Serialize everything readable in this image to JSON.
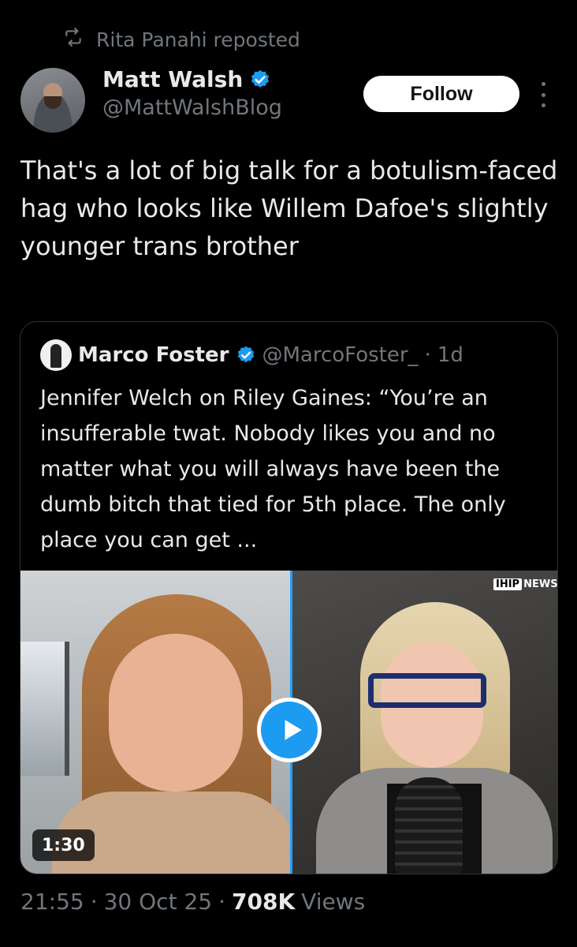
{
  "repost": {
    "icon": "retweet-icon",
    "text": "Rita Panahi reposted"
  },
  "author": {
    "name": "Matt Walsh",
    "handle": "@MattWalshBlog",
    "verified_color": "#1d9bf0"
  },
  "follow_label": "Follow",
  "tweet": {
    "text": "That's a lot of big talk for a botulism-faced hag who looks like Willem Dafoe's slightly younger trans brother"
  },
  "quote": {
    "name": "Marco Foster",
    "handle": "@MarcoFoster_",
    "separator": "·",
    "time": "1d",
    "text": "Jennifer Welch on Riley Gaines: “You’re an insufferable twat. Nobody likes you and no matter what you will always have been the dumb bitch that tied for 5th place. The only place you can get ...",
    "video": {
      "duration": "1:30",
      "logo_box": "IHIP",
      "logo_text": "NEWS",
      "play_color": "#1d9bf0"
    }
  },
  "meta": {
    "time": "21:55",
    "sep1": "·",
    "date": "30 Oct 25",
    "sep2": "·",
    "views_count": "708K",
    "views_label": "Views"
  }
}
